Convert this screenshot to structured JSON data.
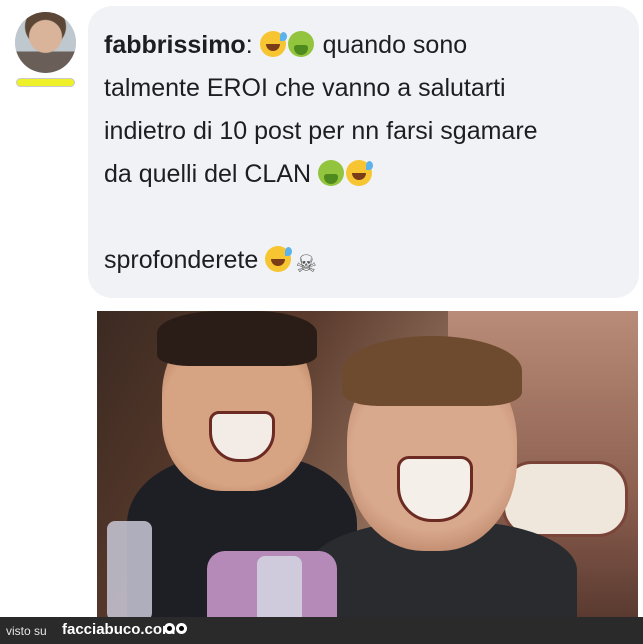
{
  "avatar": {
    "badge_color": "#eef02a"
  },
  "post": {
    "username": "fabbrissimo",
    "separator": ":",
    "lines": {
      "line1": "quando sono",
      "line2": "talmente EROI che vanno a salutarti",
      "line3": "indietro di 10 post per nn farsi sgamare",
      "line4": "da quelli del CLAN",
      "line5": "sprofonderete"
    },
    "emojis": [
      "grinning-sweat",
      "nauseated",
      "nauseated",
      "grinning-sweat",
      "grinning-sweat",
      "skull-crossbones"
    ],
    "bubble_color": "#f1f2f6"
  },
  "footer": {
    "visto": "visto su",
    "site": "facciabuco.com"
  }
}
